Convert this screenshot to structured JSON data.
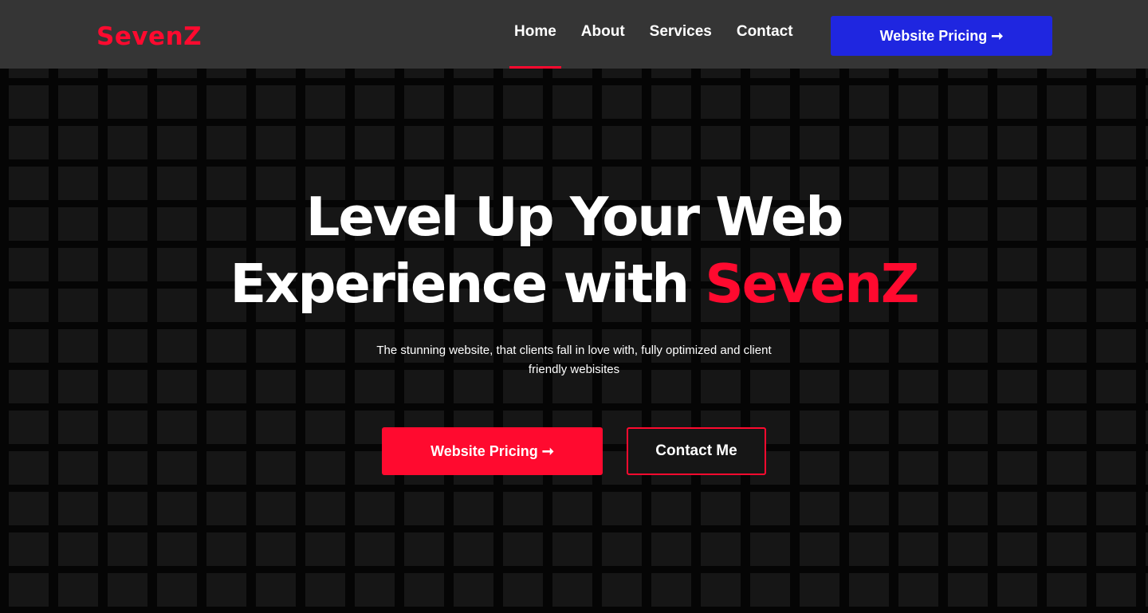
{
  "brand": {
    "name": "SevenZ",
    "accent_color": "#ff0a2f",
    "header_bg": "#353535",
    "cta_blue": "#1f26e0"
  },
  "nav": {
    "items": [
      {
        "label": "Home",
        "active": true
      },
      {
        "label": "About",
        "active": false
      },
      {
        "label": "Services",
        "active": false
      },
      {
        "label": "Contact",
        "active": false
      }
    ],
    "cta_label": "Website Pricing ➞"
  },
  "hero": {
    "headline_line1": "Level Up Your Web",
    "headline_line2_prefix": "Experience with ",
    "headline_line2_accent": "SevenZ",
    "subtitle": "The stunning website, that clients fall in love with, fully optimized and client friendly webisites",
    "primary_button": "Website Pricing ➞",
    "secondary_button": "Contact Me"
  }
}
